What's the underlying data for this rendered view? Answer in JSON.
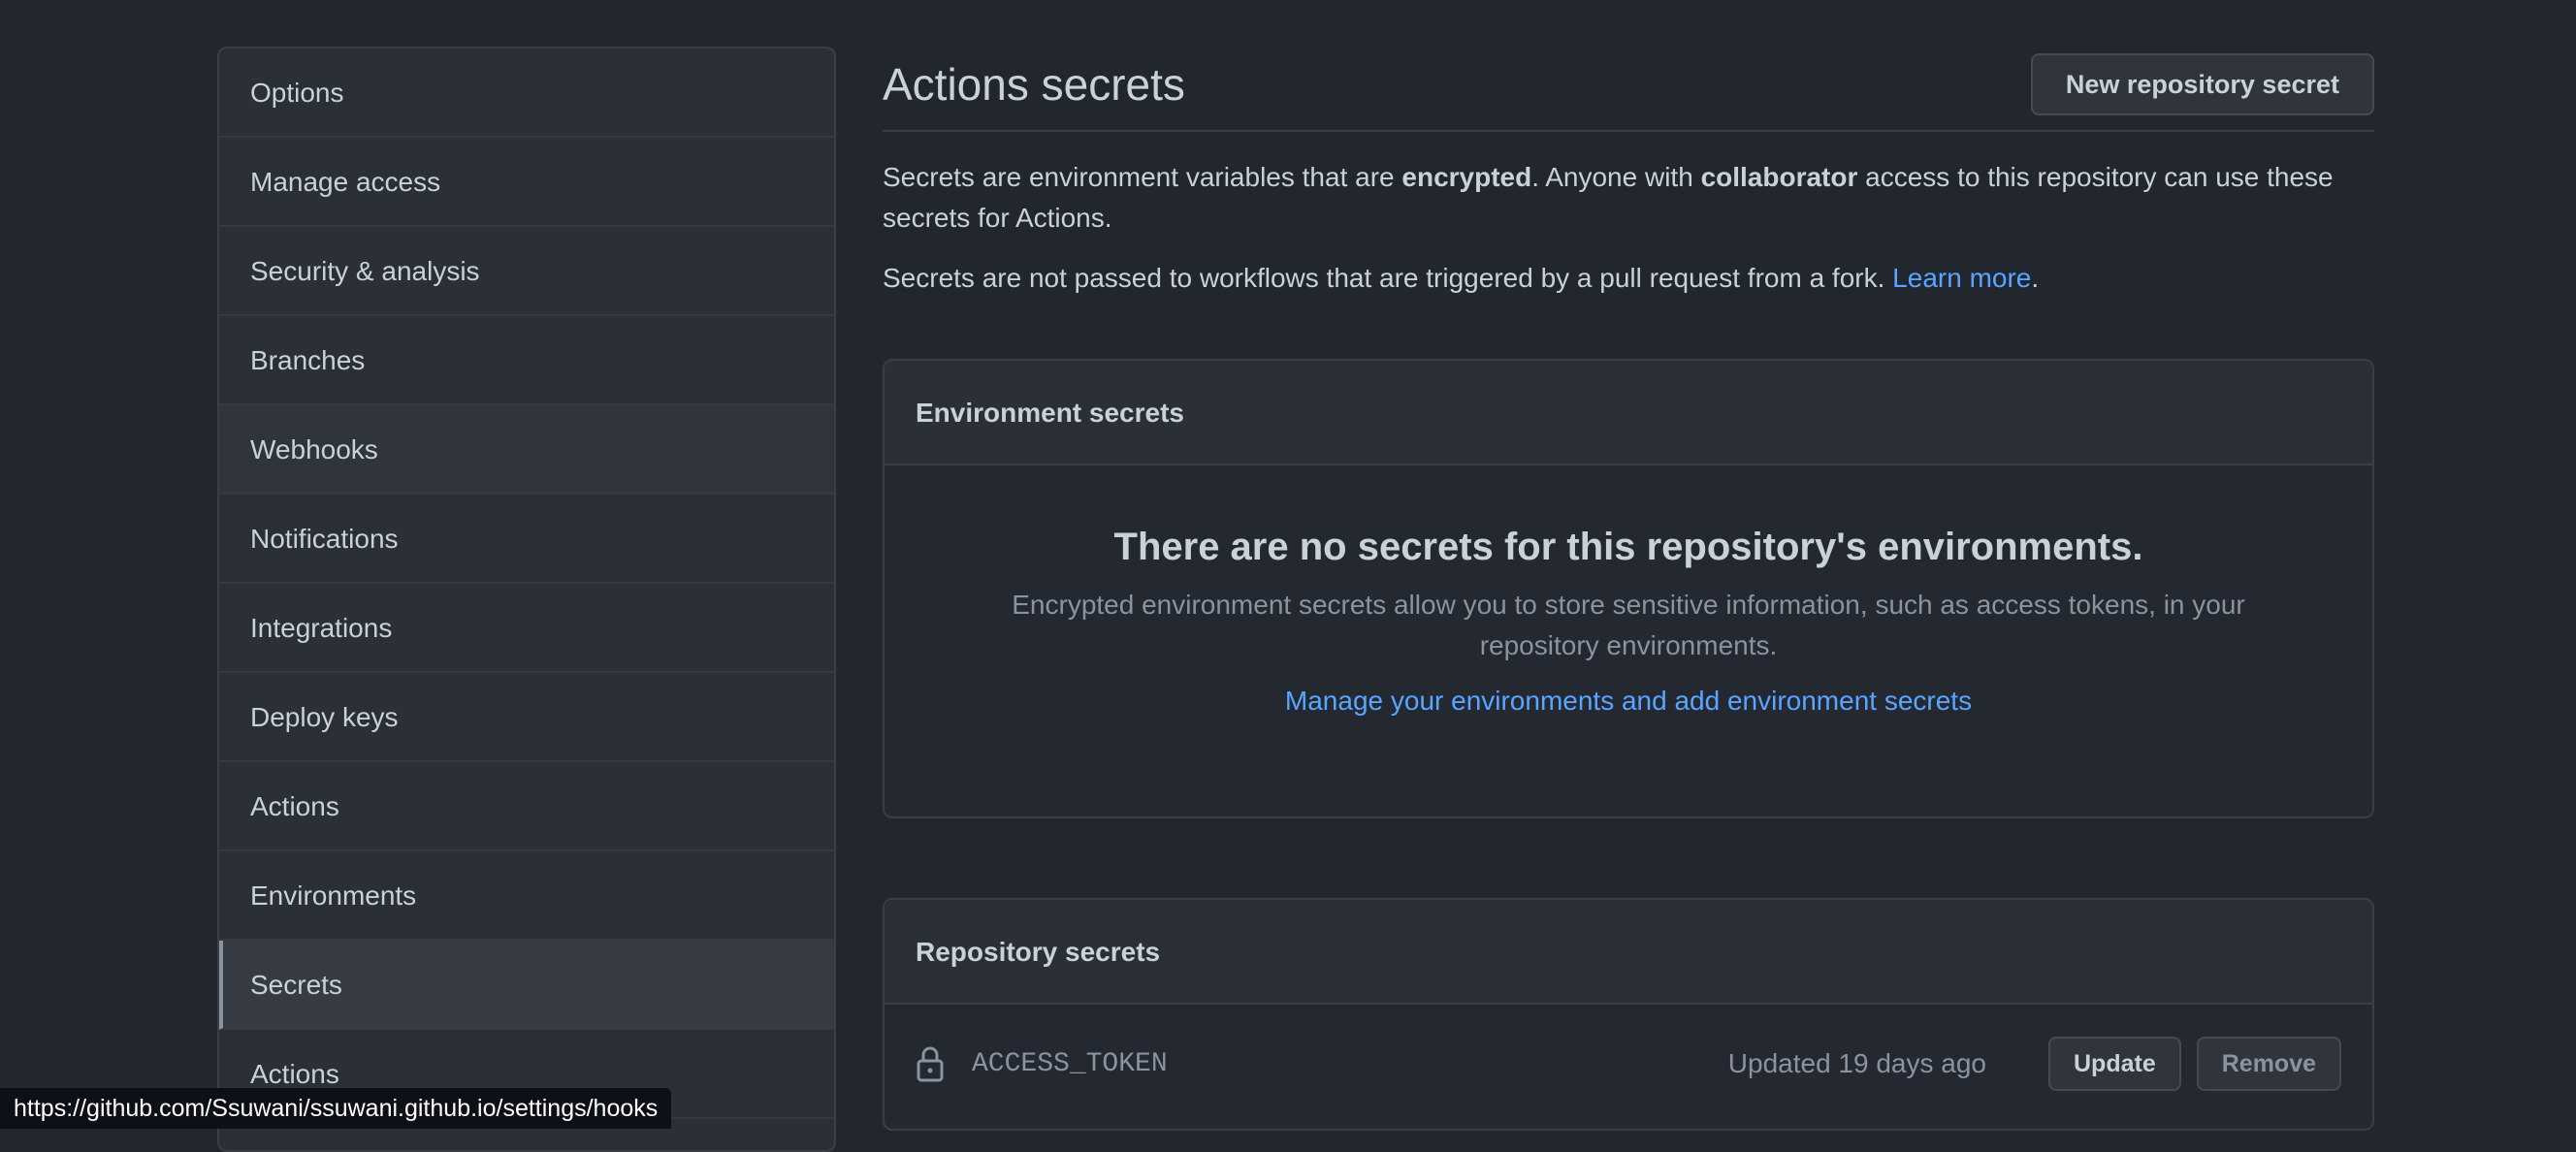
{
  "sidebar": {
    "items": [
      {
        "label": "Options"
      },
      {
        "label": "Manage access"
      },
      {
        "label": "Security & analysis"
      },
      {
        "label": "Branches"
      },
      {
        "label": "Webhooks"
      },
      {
        "label": "Notifications"
      },
      {
        "label": "Integrations"
      },
      {
        "label": "Deploy keys"
      },
      {
        "label": "Actions"
      },
      {
        "label": "Environments"
      },
      {
        "label": "Secrets"
      },
      {
        "label": "Actions"
      }
    ],
    "selected": "Secrets"
  },
  "header": {
    "title": "Actions secrets",
    "new_secret_button": "New repository secret"
  },
  "description": {
    "line1_a": "Secrets are environment variables that are ",
    "line1_b": "encrypted",
    "line1_c": ". Anyone with ",
    "line1_d": "collaborator",
    "line1_e": " access to this repository can use these secrets for Actions.",
    "line2_a": "Secrets are not passed to workflows that are triggered by a pull request from a fork. ",
    "line2_link": "Learn more",
    "line2_end": "."
  },
  "environment_secrets": {
    "header": "Environment secrets",
    "blank_title": "There are no secrets for this repository's environments.",
    "blank_text": "Encrypted environment secrets allow you to store sensitive information, such as access tokens, in your repository environments.",
    "manage_link": "Manage your environments and add environment secrets"
  },
  "repository_secrets": {
    "header": "Repository secrets",
    "rows": [
      {
        "name": "ACCESS_TOKEN",
        "updated": "Updated 19 days ago",
        "update_label": "Update",
        "remove_label": "Remove"
      }
    ]
  },
  "status_bar": {
    "url": "https://github.com/Ssuwani/ssuwani.github.io/settings/hooks"
  },
  "colors": {
    "background": "#22262e",
    "link": "#58a6ff",
    "text": "#c9d1d9",
    "muted": "#8b949e"
  },
  "icons": {
    "secret_row": "lock-icon"
  }
}
